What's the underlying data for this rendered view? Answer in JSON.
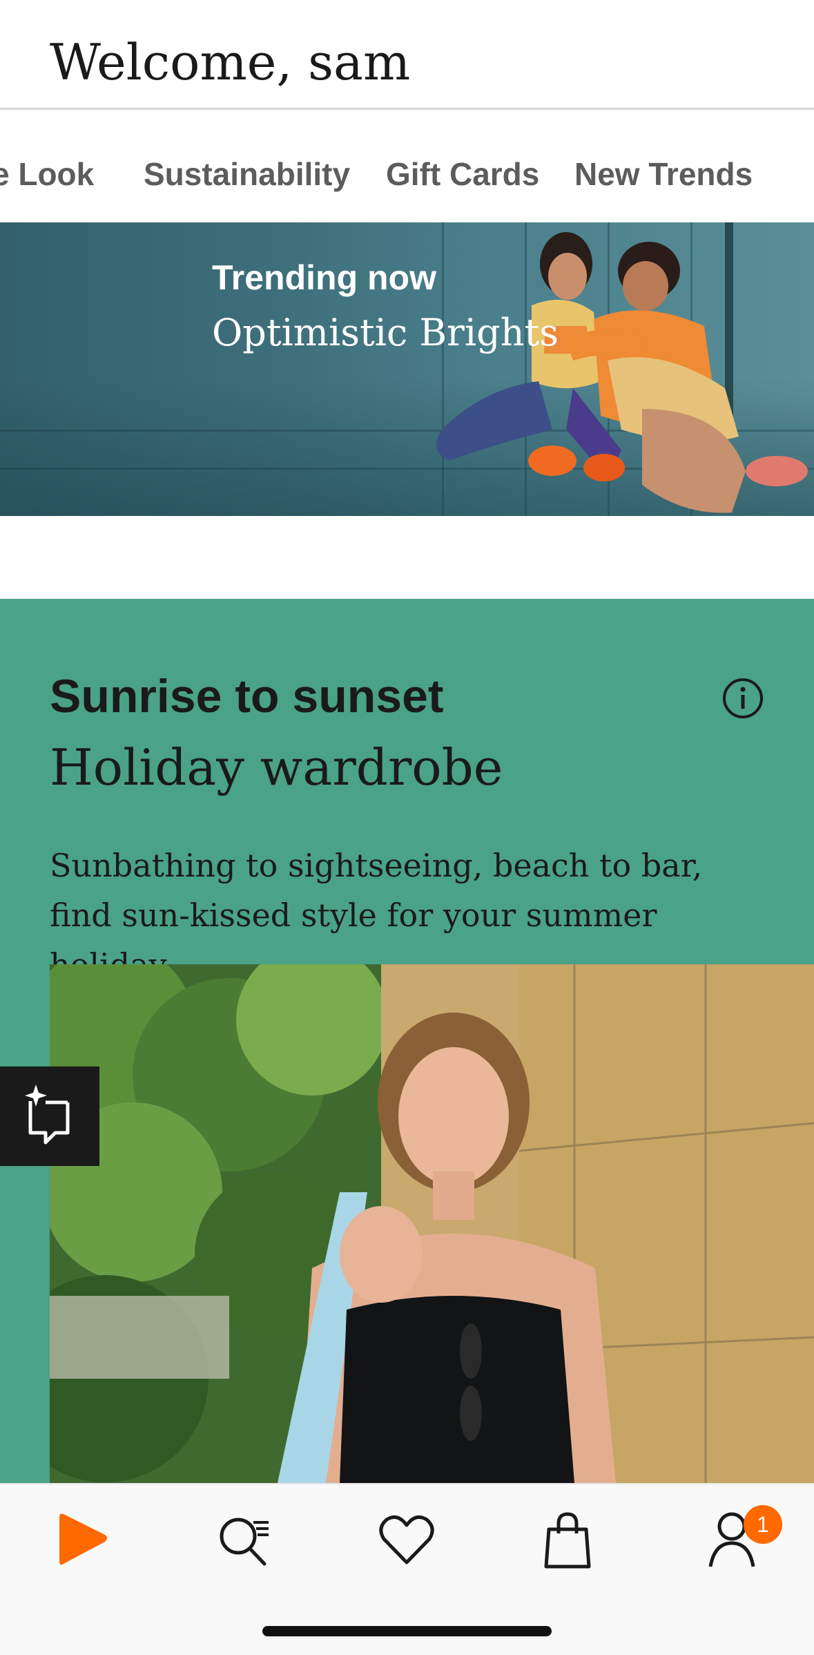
{
  "header": {
    "greeting": "Welcome, sam"
  },
  "nav": {
    "items": [
      {
        "label": "e Look"
      },
      {
        "label": "Sustainability"
      },
      {
        "label": "Gift Cards"
      },
      {
        "label": "New Trends"
      }
    ]
  },
  "hero": {
    "kicker": "Trending now",
    "title": "Optimistic Brights"
  },
  "promo": {
    "kicker": "Sunrise to sunset",
    "title": "Holiday wardrobe",
    "text": "Sunbathing to sightseeing, beach to bar, find sun-kissed style for your summer holiday.",
    "background_color": "#4aa287"
  },
  "tab_bar": {
    "items": [
      {
        "icon": "home-logo-icon"
      },
      {
        "icon": "search-icon"
      },
      {
        "icon": "heart-icon"
      },
      {
        "icon": "bag-icon"
      },
      {
        "icon": "profile-icon"
      }
    ],
    "profile_badge": "1",
    "accent_color": "#ff6900"
  }
}
